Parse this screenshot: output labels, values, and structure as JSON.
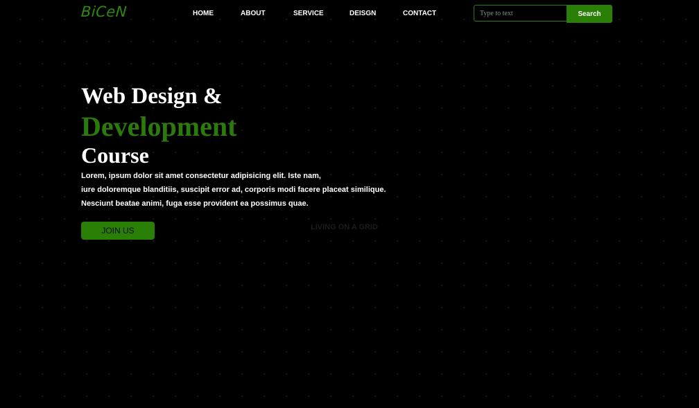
{
  "brand": {
    "logo_text": "BiCeN",
    "accent_color": "#2b7a0b"
  },
  "nav": {
    "items": [
      {
        "label": "HOME"
      },
      {
        "label": "ABOUT"
      },
      {
        "label": "SERVICE"
      },
      {
        "label": "DEISGN"
      },
      {
        "label": "CONTACT"
      }
    ]
  },
  "search": {
    "value": "",
    "placeholder": "Type to text",
    "button_label": "Search"
  },
  "hero": {
    "title_line1": "Web Design &",
    "title_line2": "Development",
    "title_line3": "Course",
    "description_lines": [
      "Lorem, ipsum dolor sit amet consectetur adipisicing elit. Iste nam,",
      "iure doloremque blanditiis, suscipit error ad, corporis modi facere placeat similique.",
      "Nesciunt beatae animi, fuga esse provident ea possimus quae."
    ],
    "cta_label": "JOIN US"
  },
  "background": {
    "watermark_text": "LIVING ON A GRID"
  }
}
